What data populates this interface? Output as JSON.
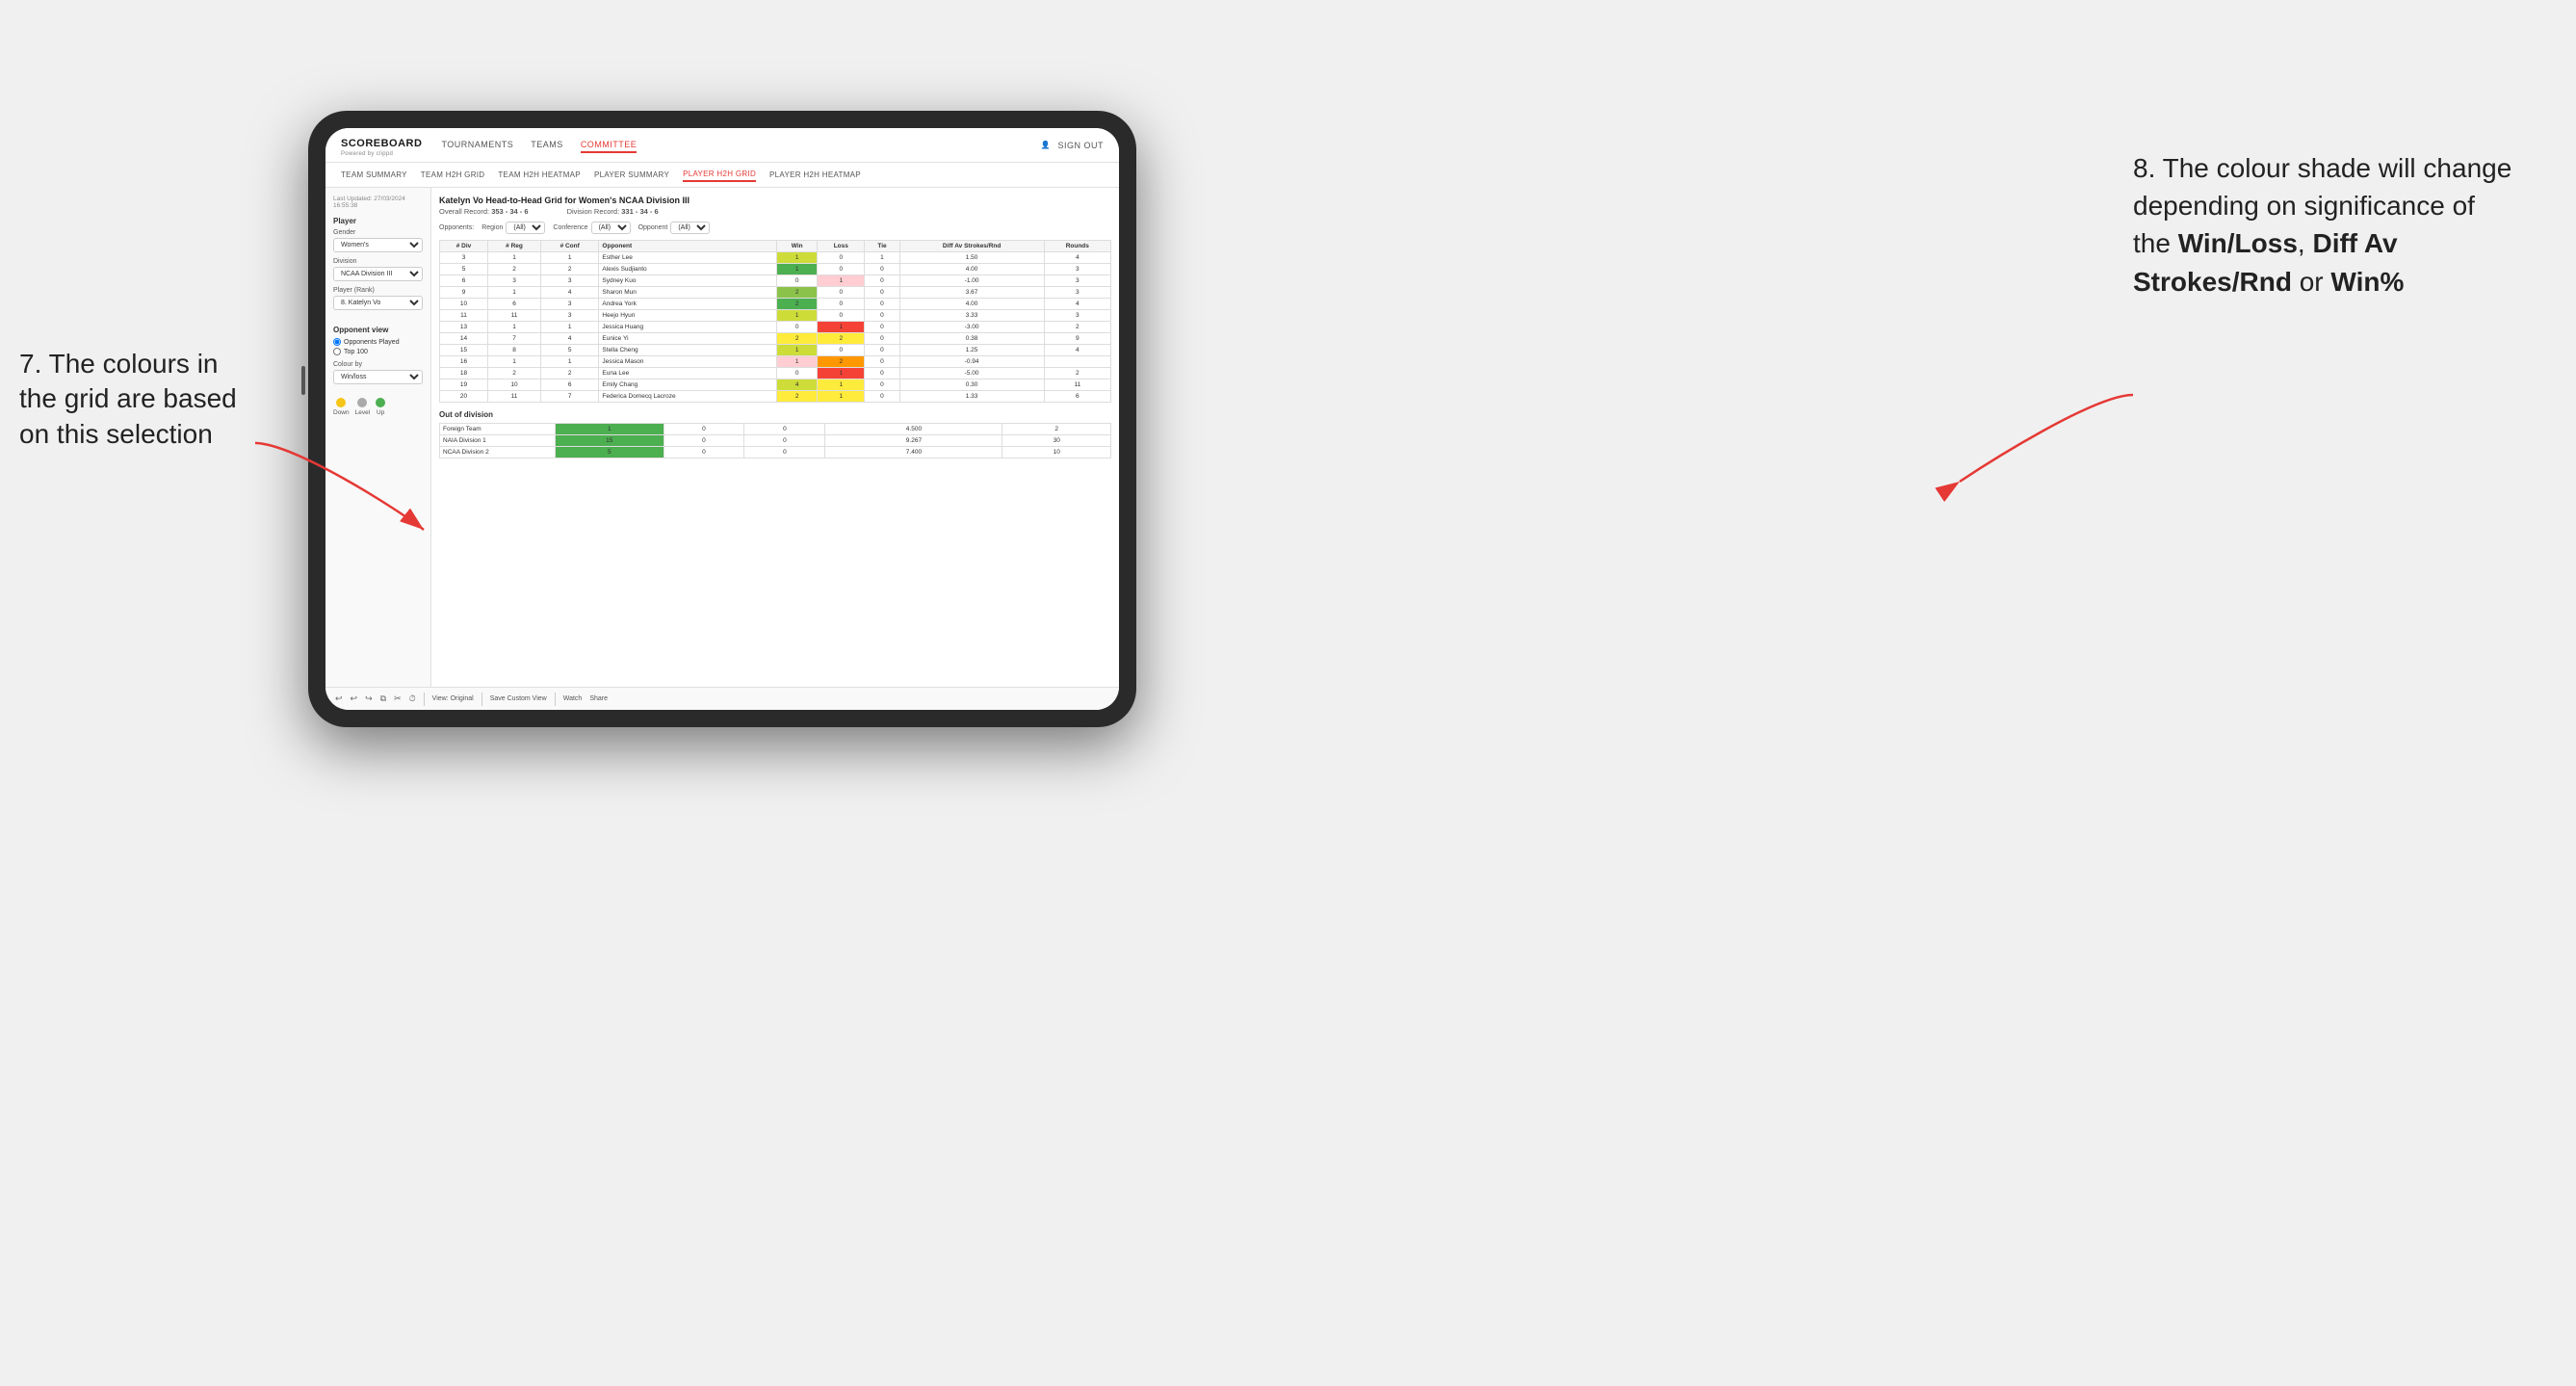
{
  "annotations": {
    "left": {
      "line1": "7. The colours in",
      "line2": "the grid are based",
      "line3": "on this selection"
    },
    "right": {
      "intro": "8. The colour shade will change depending on significance of the ",
      "bold1": "Win/Loss",
      "sep1": ", ",
      "bold2": "Diff Av Strokes/Rnd",
      "sep2": " or ",
      "bold3": "Win%"
    }
  },
  "header": {
    "logo": "SCOREBOARD",
    "logo_sub": "Powered by clippd",
    "nav": [
      "TOURNAMENTS",
      "TEAMS",
      "COMMITTEE"
    ],
    "active_nav": "COMMITTEE",
    "sign_in": "Sign out",
    "sub_nav": [
      "TEAM SUMMARY",
      "TEAM H2H GRID",
      "TEAM H2H HEATMAP",
      "PLAYER SUMMARY",
      "PLAYER H2H GRID",
      "PLAYER H2H HEATMAP"
    ],
    "active_sub_nav": "PLAYER H2H GRID"
  },
  "sidebar": {
    "timestamp": "Last Updated: 27/03/2024 16:55:38",
    "player_section": "Player",
    "gender_label": "Gender",
    "gender_value": "Women's",
    "division_label": "Division",
    "division_value": "NCAA Division III",
    "rank_label": "Player (Rank)",
    "rank_value": "8. Katelyn Vo",
    "opponent_view_label": "Opponent view",
    "radio1": "Opponents Played",
    "radio2": "Top 100",
    "colour_by_label": "Colour by",
    "colour_by_value": "Win/loss",
    "legend": {
      "down_color": "#f5c518",
      "level_color": "#aaa",
      "up_color": "#4caf50",
      "down_label": "Down",
      "level_label": "Level",
      "up_label": "Up"
    }
  },
  "grid": {
    "title": "Katelyn Vo Head-to-Head Grid for Women's NCAA Division III",
    "overall_record_label": "Overall Record:",
    "overall_record": "353 - 34 - 6",
    "division_record_label": "Division Record:",
    "division_record": "331 - 34 - 6",
    "filters": {
      "opponents_label": "Opponents:",
      "region_label": "Region",
      "conference_label": "Conference",
      "opponent_label": "Opponent",
      "all": "(All)"
    },
    "table_headers": [
      "# Div",
      "# Reg",
      "# Conf",
      "Opponent",
      "Win",
      "Loss",
      "Tie",
      "Diff Av Strokes/Rnd",
      "Rounds"
    ],
    "rows": [
      {
        "div": "3",
        "reg": "1",
        "conf": "1",
        "name": "Esther Lee",
        "win": "1",
        "loss": "0",
        "tie": "1",
        "diff": "1.50",
        "rounds": "4",
        "win_color": "green_light",
        "loss_color": "white",
        "tie_color": "gray"
      },
      {
        "div": "5",
        "reg": "2",
        "conf": "2",
        "name": "Alexis Sudjianto",
        "win": "1",
        "loss": "0",
        "tie": "0",
        "diff": "4.00",
        "rounds": "3",
        "win_color": "green_dark",
        "loss_color": "white",
        "tie_color": "white"
      },
      {
        "div": "6",
        "reg": "3",
        "conf": "3",
        "name": "Sydney Kuo",
        "win": "0",
        "loss": "1",
        "tie": "0",
        "diff": "-1.00",
        "rounds": "3",
        "win_color": "white",
        "loss_color": "red_light",
        "tie_color": "white"
      },
      {
        "div": "9",
        "reg": "1",
        "conf": "4",
        "name": "Sharon Mun",
        "win": "2",
        "loss": "0",
        "tie": "0",
        "diff": "3.67",
        "rounds": "3",
        "win_color": "green_med",
        "loss_color": "white",
        "tie_color": "white"
      },
      {
        "div": "10",
        "reg": "6",
        "conf": "3",
        "name": "Andrea York",
        "win": "2",
        "loss": "0",
        "tie": "0",
        "diff": "4.00",
        "rounds": "4",
        "win_color": "green_dark",
        "loss_color": "white",
        "tie_color": "white"
      },
      {
        "div": "11",
        "reg": "11",
        "conf": "3",
        "name": "Heejo Hyun",
        "win": "1",
        "loss": "0",
        "tie": "0",
        "diff": "3.33",
        "rounds": "3",
        "win_color": "green_light",
        "loss_color": "white",
        "tie_color": "white"
      },
      {
        "div": "13",
        "reg": "1",
        "conf": "1",
        "name": "Jessica Huang",
        "win": "0",
        "loss": "1",
        "tie": "0",
        "diff": "-3.00",
        "rounds": "2",
        "win_color": "white",
        "loss_color": "red_dark",
        "tie_color": "white"
      },
      {
        "div": "14",
        "reg": "7",
        "conf": "4",
        "name": "Eunice Yi",
        "win": "2",
        "loss": "2",
        "tie": "0",
        "diff": "0.38",
        "rounds": "9",
        "win_color": "yellow",
        "loss_color": "yellow",
        "tie_color": "white"
      },
      {
        "div": "15",
        "reg": "8",
        "conf": "5",
        "name": "Stella Cheng",
        "win": "1",
        "loss": "0",
        "tie": "0",
        "diff": "1.25",
        "rounds": "4",
        "win_color": "green_light",
        "loss_color": "white",
        "tie_color": "white"
      },
      {
        "div": "16",
        "reg": "1",
        "conf": "1",
        "name": "Jessica Mason",
        "win": "1",
        "loss": "2",
        "tie": "0",
        "diff": "-0.94",
        "rounds": "",
        "win_color": "red_light",
        "loss_color": "orange",
        "tie_color": "white"
      },
      {
        "div": "18",
        "reg": "2",
        "conf": "2",
        "name": "Euna Lee",
        "win": "0",
        "loss": "1",
        "tie": "0",
        "diff": "-5.00",
        "rounds": "2",
        "win_color": "white",
        "loss_color": "red_dark",
        "tie_color": "white"
      },
      {
        "div": "19",
        "reg": "10",
        "conf": "6",
        "name": "Emily Chang",
        "win": "4",
        "loss": "1",
        "tie": "0",
        "diff": "0.30",
        "rounds": "11",
        "win_color": "green_light",
        "loss_color": "yellow",
        "tie_color": "white"
      },
      {
        "div": "20",
        "reg": "11",
        "conf": "7",
        "name": "Federica Domecq Lacroze",
        "win": "2",
        "loss": "1",
        "tie": "0",
        "diff": "1.33",
        "rounds": "6",
        "win_color": "yellow",
        "loss_color": "yellow",
        "tie_color": "white"
      }
    ],
    "out_of_division_label": "Out of division",
    "out_of_division_rows": [
      {
        "name": "Foreign Team",
        "win": "1",
        "loss": "0",
        "tie": "0",
        "diff": "4.500",
        "rounds": "2",
        "win_color": "green_dark"
      },
      {
        "name": "NAIA Division 1",
        "win": "15",
        "loss": "0",
        "tie": "0",
        "diff": "9.267",
        "rounds": "30",
        "win_color": "green_dark"
      },
      {
        "name": "NCAA Division 2",
        "win": "5",
        "loss": "0",
        "tie": "0",
        "diff": "7.400",
        "rounds": "10",
        "win_color": "green_dark"
      }
    ]
  },
  "toolbar": {
    "view_original": "View: Original",
    "save_custom": "Save Custom View",
    "watch": "Watch",
    "share": "Share"
  }
}
